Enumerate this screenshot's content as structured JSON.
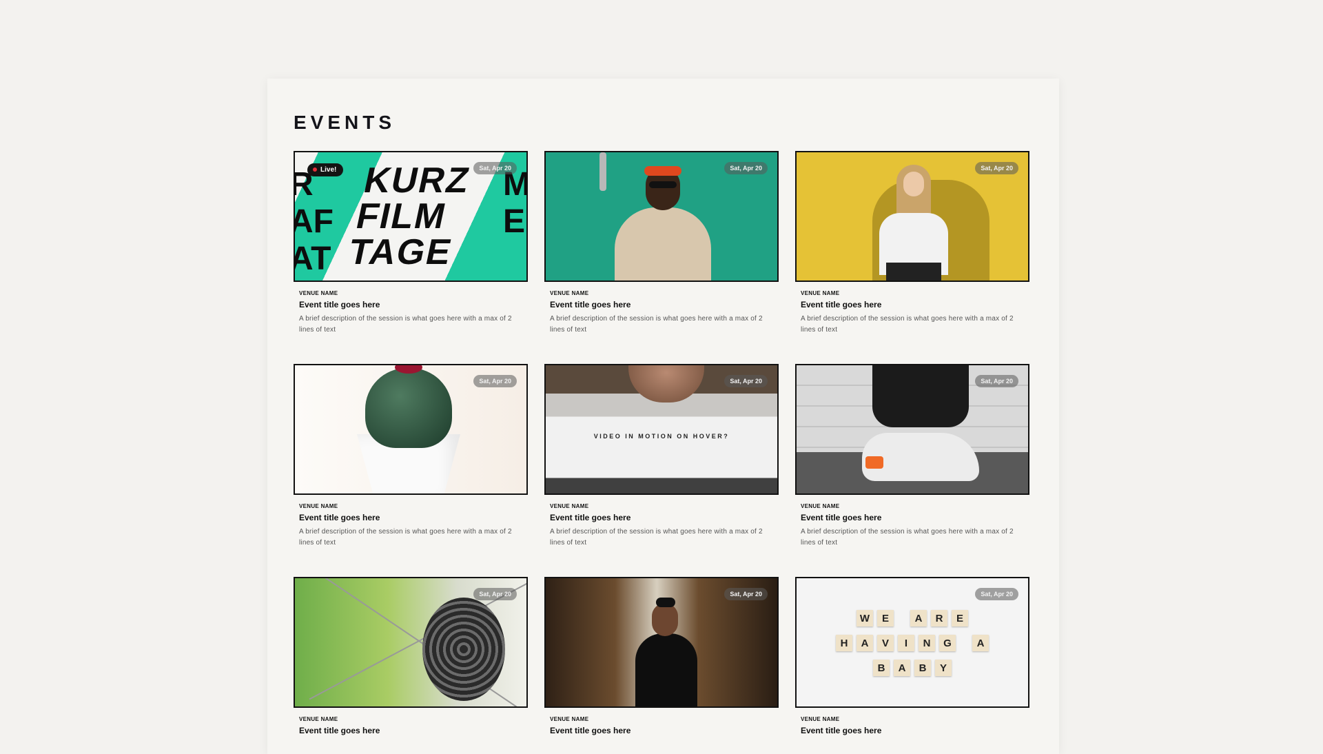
{
  "page": {
    "title": "EVENTS"
  },
  "events": [
    {
      "date": "Sat, Apr 20",
      "live": "Live!",
      "venue": "VENUE NAME",
      "title": "Event title goes here",
      "description": "A brief description of the session is what goes here with a max of 2 lines of text",
      "poster_words": [
        "KURZ",
        "FILM",
        "TAGE"
      ]
    },
    {
      "date": "Sat, Apr 20",
      "venue": "VENUE NAME",
      "title": "Event title goes here",
      "description": "A brief description of the session is what goes here with a max of 2 lines of text"
    },
    {
      "date": "Sat, Apr 20",
      "venue": "VENUE NAME",
      "title": "Event title goes here",
      "description": "A brief description of the session is what goes here with a max of 2 lines of text"
    },
    {
      "date": "Sat, Apr 20",
      "venue": "VENUE NAME",
      "title": "Event title goes here",
      "description": "A brief description of the session is what goes here with a max of 2 lines of text"
    },
    {
      "date": "Sat, Apr 20",
      "overlay": "VIDEO IN MOTION ON HOVER?",
      "venue": "VENUE NAME",
      "title": "Event title goes here",
      "description": "A brief description of the session is what goes here with a max of 2 lines of text"
    },
    {
      "date": "Sat, Apr 20",
      "venue": "VENUE NAME",
      "title": "Event title goes here",
      "description": "A brief description of the session is what goes here with a max of 2 lines of text"
    },
    {
      "date": "Sat, Apr 20",
      "venue": "VENUE NAME",
      "title": "Event title goes here"
    },
    {
      "date": "Sat, Apr 20",
      "venue": "VENUE NAME",
      "title": "Event title goes here"
    },
    {
      "date": "Sat, Apr 20",
      "venue": "VENUE NAME",
      "title": "Event title goes here",
      "tile_rows": [
        "WE ARE",
        "HAVING A",
        "BABY"
      ]
    }
  ]
}
